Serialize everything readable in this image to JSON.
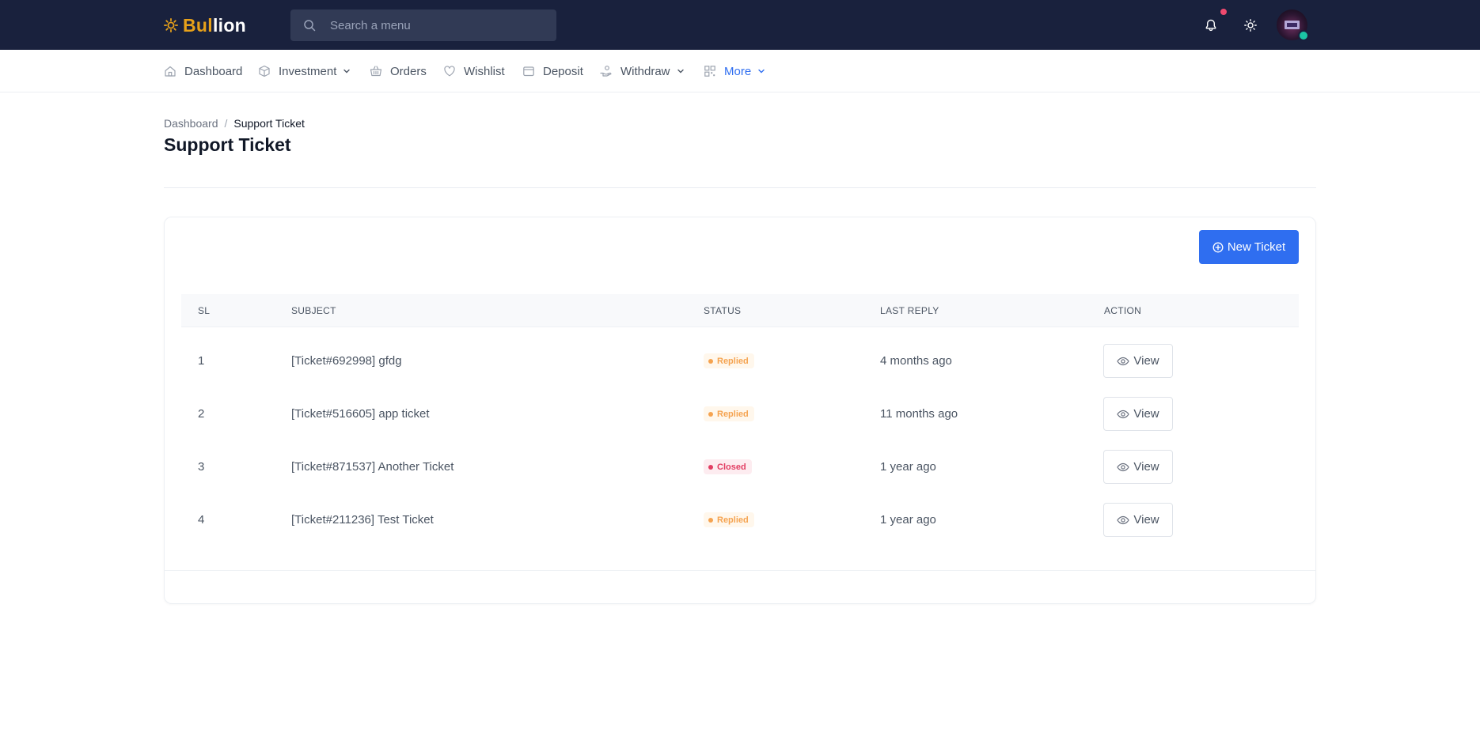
{
  "brand": {
    "name_part1": "Bul",
    "name_part2": "lion",
    "accent": "#e7a11a",
    "icon": "sun-logo-icon"
  },
  "search": {
    "placeholder": "Search a menu",
    "value": ""
  },
  "header_icons": [
    "bell-icon",
    "sun-icon",
    "avatar"
  ],
  "nav": {
    "items": [
      {
        "label": "Dashboard",
        "icon": "home-icon"
      },
      {
        "label": "Investment",
        "icon": "cube-icon",
        "dropdown": true
      },
      {
        "label": "Orders",
        "icon": "basket-icon"
      },
      {
        "label": "Wishlist",
        "icon": "heart-icon"
      },
      {
        "label": "Deposit",
        "icon": "wallet-icon"
      },
      {
        "label": "Withdraw",
        "icon": "hand-coin-icon",
        "dropdown": true
      },
      {
        "label": "More",
        "icon": "grid-icon",
        "dropdown": true,
        "active": true
      }
    ]
  },
  "breadcrumb": {
    "parent": "Dashboard",
    "separator": "/",
    "current": "Support Ticket"
  },
  "page": {
    "title": "Support Ticket"
  },
  "actions": {
    "new_ticket": "New Ticket"
  },
  "table": {
    "headers": {
      "sl": "SL",
      "subject": "SUBJECT",
      "status": "STATUS",
      "last_reply": "LAST REPLY",
      "action": "ACTION"
    },
    "rows": [
      {
        "sl": "1",
        "subject": "[Ticket#692998] gfdg",
        "status": "Replied",
        "last_reply": "4 months ago",
        "action": "View"
      },
      {
        "sl": "2",
        "subject": "[Ticket#516605] app ticket",
        "status": "Replied",
        "last_reply": "11 months ago",
        "action": "View"
      },
      {
        "sl": "3",
        "subject": "[Ticket#871537] Another Ticket",
        "status": "Closed",
        "last_reply": "1 year ago",
        "action": "View"
      },
      {
        "sl": "4",
        "subject": "[Ticket#211236] Test Ticket",
        "status": "Replied",
        "last_reply": "1 year ago",
        "action": "View"
      }
    ]
  },
  "colors": {
    "topbar": "#19213d",
    "primary": "#2f6ef0",
    "replied": "#f5a350",
    "closed": "#e23e63",
    "notification": "#ef4a6f",
    "online": "#1bc5a5"
  }
}
